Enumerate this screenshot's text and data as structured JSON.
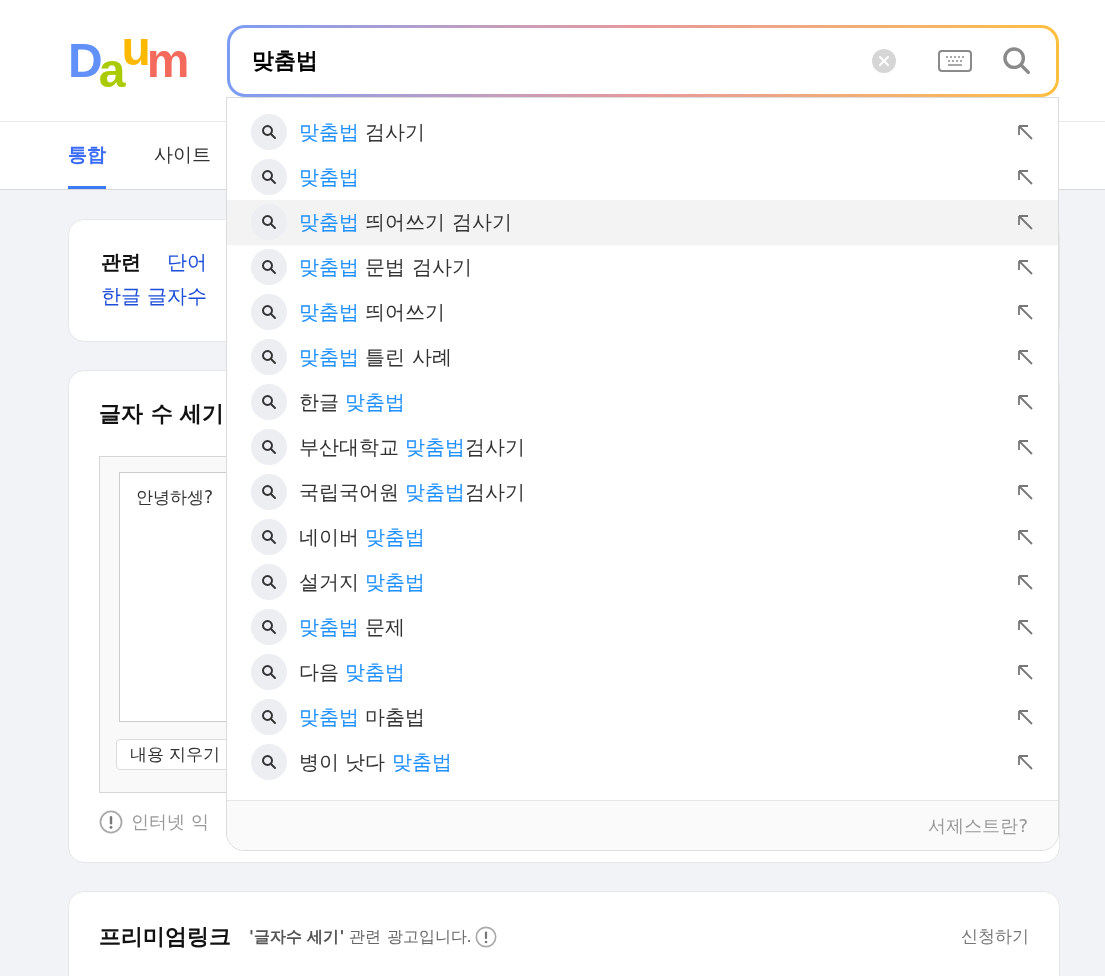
{
  "logo": [
    {
      "text": "D",
      "color": "#6190f8"
    },
    {
      "text": "a",
      "color": "#a9cb00"
    },
    {
      "text": "u",
      "color": "#fcb900"
    },
    {
      "text": "m",
      "color": "#f46b5d"
    }
  ],
  "search": {
    "value": "맞춤법"
  },
  "tabs": [
    {
      "label": "통합",
      "selected": true
    },
    {
      "label": "사이트",
      "selected": false
    }
  ],
  "related": {
    "title": "관련",
    "links": [
      "단어",
      "한글 글자수"
    ]
  },
  "counter": {
    "title": "글자 수 세기",
    "text": "안녕하셍?",
    "clear_button": "내용 지우기",
    "notice": "인터넷 익"
  },
  "premium": {
    "title": "프리미엄링크",
    "note": "**'글자수 세기'** 관련 광고입니다.",
    "apply": "신청하기"
  },
  "suggestions": [
    {
      "parts": [
        {
          "text": "맞춤법",
          "highlight": true
        },
        {
          "text": " 검사기",
          "highlight": false
        }
      ],
      "selected": false
    },
    {
      "parts": [
        {
          "text": "맞춤법",
          "highlight": true
        }
      ],
      "selected": false
    },
    {
      "parts": [
        {
          "text": "맞춤법",
          "highlight": true
        },
        {
          "text": " 띄어쓰기 검사기",
          "highlight": false
        }
      ],
      "selected": true
    },
    {
      "parts": [
        {
          "text": "맞춤법",
          "highlight": true
        },
        {
          "text": " 문법 검사기",
          "highlight": false
        }
      ],
      "selected": false
    },
    {
      "parts": [
        {
          "text": "맞춤법",
          "highlight": true
        },
        {
          "text": " 띄어쓰기",
          "highlight": false
        }
      ],
      "selected": false
    },
    {
      "parts": [
        {
          "text": "맞춤법",
          "highlight": true
        },
        {
          "text": " 틀린 사례",
          "highlight": false
        }
      ],
      "selected": false
    },
    {
      "parts": [
        {
          "text": "한글 ",
          "highlight": false
        },
        {
          "text": "맞춤법",
          "highlight": true
        }
      ],
      "selected": false
    },
    {
      "parts": [
        {
          "text": "부산대학교 ",
          "highlight": false
        },
        {
          "text": "맞춤법",
          "highlight": true
        },
        {
          "text": "검사기",
          "highlight": false
        }
      ],
      "selected": false
    },
    {
      "parts": [
        {
          "text": "국립국어원 ",
          "highlight": false
        },
        {
          "text": "맞춤법",
          "highlight": true
        },
        {
          "text": "검사기",
          "highlight": false
        }
      ],
      "selected": false
    },
    {
      "parts": [
        {
          "text": "네이버 ",
          "highlight": false
        },
        {
          "text": "맞춤법",
          "highlight": true
        }
      ],
      "selected": false
    },
    {
      "parts": [
        {
          "text": "설거지 ",
          "highlight": false
        },
        {
          "text": "맞춤법",
          "highlight": true
        }
      ],
      "selected": false
    },
    {
      "parts": [
        {
          "text": "맞춤법",
          "highlight": true
        },
        {
          "text": " 문제",
          "highlight": false
        }
      ],
      "selected": false
    },
    {
      "parts": [
        {
          "text": "다음 ",
          "highlight": false
        },
        {
          "text": "맞춤법",
          "highlight": true
        }
      ],
      "selected": false
    },
    {
      "parts": [
        {
          "text": "맞춤법",
          "highlight": true
        },
        {
          "text": " 마춤법",
          "highlight": false
        }
      ],
      "selected": false
    },
    {
      "parts": [
        {
          "text": "병이 낫다 ",
          "highlight": false
        },
        {
          "text": "맞춤법",
          "highlight": true
        }
      ],
      "selected": false
    }
  ],
  "suggest_footer": "서제스트란?"
}
